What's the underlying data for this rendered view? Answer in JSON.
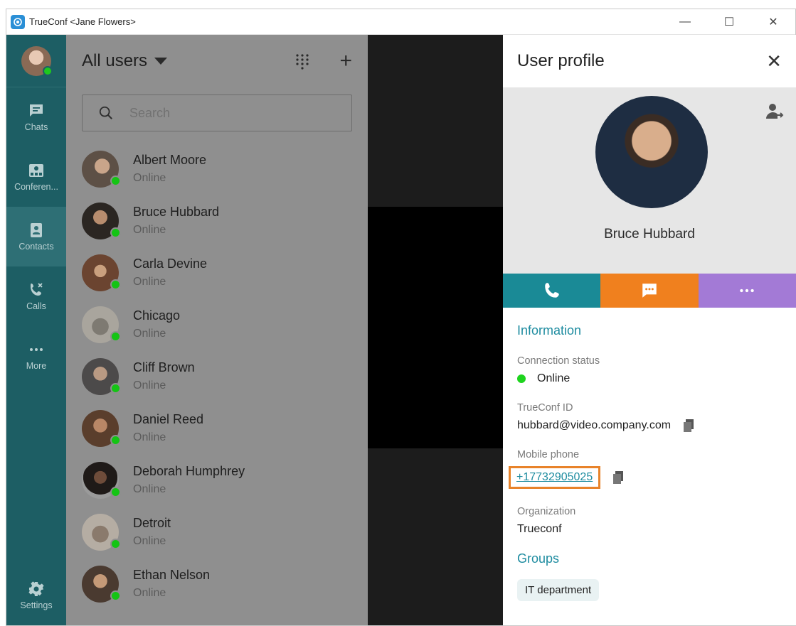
{
  "window": {
    "title": "TrueConf <Jane Flowers>"
  },
  "rail": {
    "items": [
      {
        "label": "Chats"
      },
      {
        "label": "Conferen..."
      },
      {
        "label": "Contacts"
      },
      {
        "label": "Calls"
      },
      {
        "label": "More"
      }
    ],
    "settings_label": "Settings"
  },
  "contacts": {
    "heading": "All users",
    "search_placeholder": "Search",
    "list": [
      {
        "name": "Albert Moore",
        "status": "Online"
      },
      {
        "name": "Bruce Hubbard",
        "status": "Online"
      },
      {
        "name": "Carla Devine",
        "status": "Online"
      },
      {
        "name": "Chicago",
        "status": "Online"
      },
      {
        "name": "Cliff Brown",
        "status": "Online"
      },
      {
        "name": "Daniel Reed",
        "status": "Online"
      },
      {
        "name": "Deborah Humphrey",
        "status": "Online"
      },
      {
        "name": "Detroit",
        "status": "Online"
      },
      {
        "name": "Ethan Nelson",
        "status": "Online"
      }
    ]
  },
  "profile": {
    "title": "User profile",
    "name": "Bruce Hubbard",
    "info_title": "Information",
    "connection_status_label": "Connection status",
    "connection_status": "Online",
    "trueconf_id_label": "TrueConf ID",
    "trueconf_id": "hubbard@video.company.com",
    "mobile_label": "Mobile phone",
    "mobile": "+17732905025",
    "organization_label": "Organization",
    "organization": "Trueconf",
    "groups_title": "Groups",
    "group": "IT department"
  },
  "colors": {
    "rail": "#1d5e64",
    "call": "#1a8a96",
    "chat": "#f0801e",
    "more": "#a37ad6",
    "accent": "#1e8ca0",
    "highlight": "#e8832a"
  }
}
